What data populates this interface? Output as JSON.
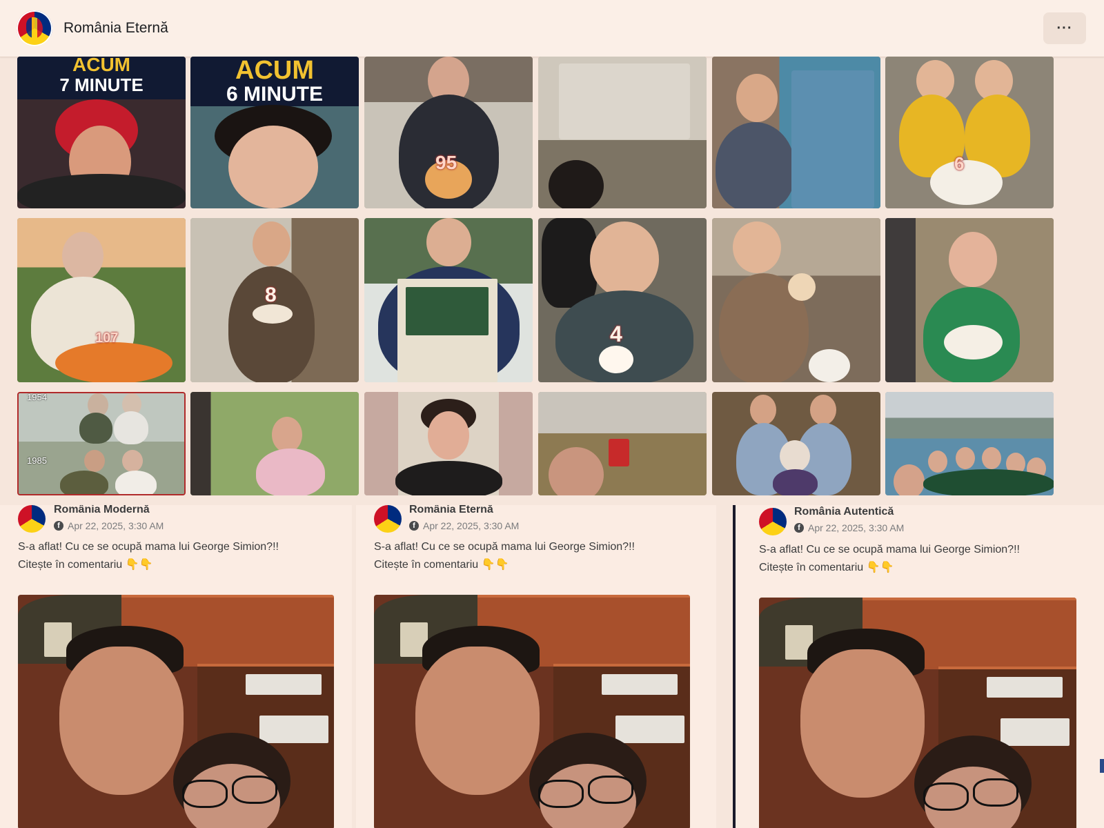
{
  "header": {
    "page_name": "România Eternă",
    "more_icon": "more-icon",
    "more_label": "···"
  },
  "grid": {
    "row1": [
      {
        "banner_line1": "ACUM",
        "banner_line2": "7 MINUTE"
      },
      {
        "banner_line1": "ACUM",
        "banner_line2": "6 MINUTE"
      },
      {
        "cake_number": "95"
      },
      {},
      {},
      {
        "cake_number": "6"
      }
    ],
    "row2": [
      {
        "cake_number": "107"
      },
      {
        "cake_number": "8"
      },
      {},
      {
        "cake_number": "4"
      },
      {},
      {}
    ],
    "row3": [
      {
        "year_top": "1954",
        "year_bottom": "1985"
      },
      {},
      {},
      {},
      {},
      {}
    ]
  },
  "posts": [
    {
      "page_name": "România Modernă",
      "date": "Apr 22, 2025, 3:30 AM",
      "text_line1": "S-a aflat! Cu ce se ocupă mama lui George Simion?!!",
      "text_line2": "Citește în comentariu 👇👇"
    },
    {
      "page_name": "România Eternă",
      "date": "Apr 22, 2025, 3:30 AM",
      "text_line1": "S-a aflat! Cu ce se ocupă mama lui George Simion?!!",
      "text_line2": "Citește în comentariu 👇👇"
    },
    {
      "page_name": "România Autentică",
      "date": "Apr 22, 2025, 3:30 AM",
      "text_line1": "S-a aflat! Cu ce se ocupă mama lui George Simion?!!",
      "text_line2": "Citește în comentariu 👇👇"
    }
  ],
  "colors": {
    "flag_blue": "#002b7f",
    "flag_yellow": "#fcd116",
    "flag_red": "#ce1126",
    "banner_bg": "#111a33"
  }
}
